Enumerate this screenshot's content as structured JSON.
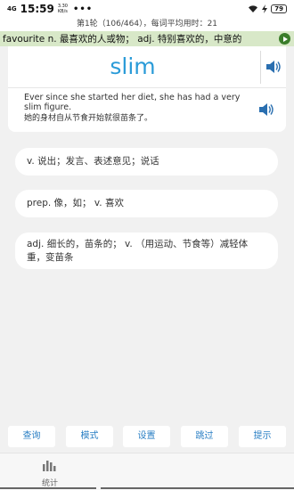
{
  "status_bar": {
    "signal": "4G",
    "time": "15:59",
    "speed_value": "3.30",
    "speed_unit": "KB/s",
    "dots": "•••",
    "battery": "79"
  },
  "progress_text": "第1轮（106/464），每词平均用时：21",
  "marquee_text": "favourite n. 最喜欢的人或物；  adj. 特别喜欢的，中意的",
  "word": {
    "text": "slim",
    "example_en": "Ever since she started her diet, she has had a very slim figure.",
    "example_cn": "她的身材自从节食开始就很苗条了。"
  },
  "options": [
    {
      "text": "v. 说出；发言、表述意见；说话"
    },
    {
      "text": "prep. 像，如；  v. 喜欢"
    },
    {
      "text": "adj. 细长的，苗条的；  v. （用运动、节食等）减轻体重，变苗条"
    }
  ],
  "toolbar": {
    "query": "查询",
    "mode": "模式",
    "settings": "设置",
    "skip": "跳过",
    "hint": "提示"
  },
  "nav": {
    "stats_label": "统计",
    "stats_icon": "bar-chart-icon"
  },
  "colors": {
    "accent_blue": "#2a9bd8",
    "marquee_bg": "#d8e8c8",
    "play_green": "#3a7d2a",
    "button_text": "#2a7fc4"
  }
}
